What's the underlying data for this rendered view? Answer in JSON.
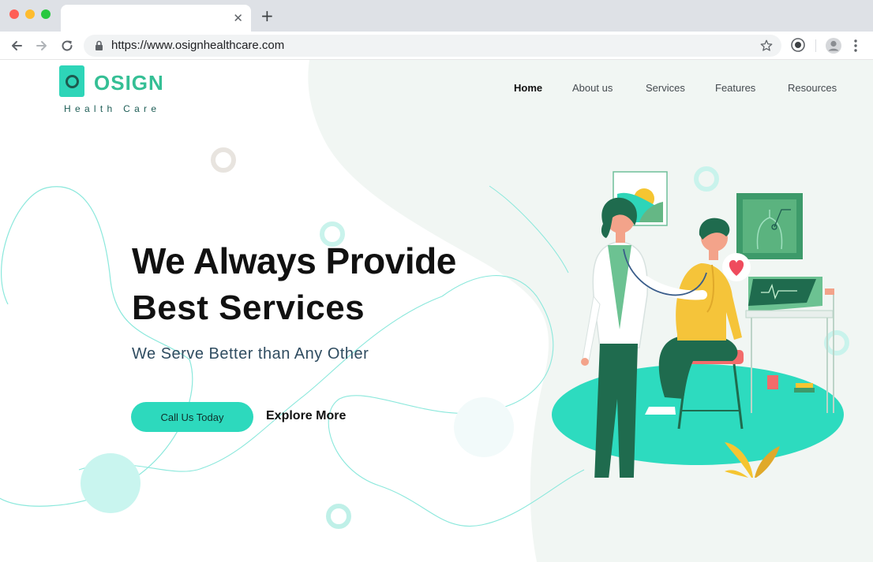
{
  "browser": {
    "tab_close": "✕",
    "new_tab": "+",
    "url": "https://www.osignhealthcare.com"
  },
  "header": {
    "logo_name": "OSIGN",
    "logo_tagline": "Health Care",
    "nav": [
      {
        "label": "Home",
        "active": true
      },
      {
        "label": "About us",
        "active": false
      },
      {
        "label": "Services",
        "active": false
      },
      {
        "label": "Features",
        "active": false
      },
      {
        "label": "Resources",
        "active": false
      }
    ]
  },
  "hero": {
    "title_line1": "We Always Provide",
    "title_line2": "Best Services",
    "subtitle": "We Serve Better than Any Other",
    "primary_button": "Call Us Today",
    "secondary_button": "Explore More"
  },
  "colors": {
    "accent": "#2dd9bd",
    "brand_green": "#35bf95",
    "dark_green": "#1f5e57",
    "blob": "#f1f6f3"
  },
  "icons": [
    "back-arrow-icon",
    "forward-arrow-icon",
    "reload-icon",
    "lock-icon",
    "star-icon",
    "extension-icon",
    "profile-icon",
    "menu-icon",
    "heart-icon"
  ]
}
